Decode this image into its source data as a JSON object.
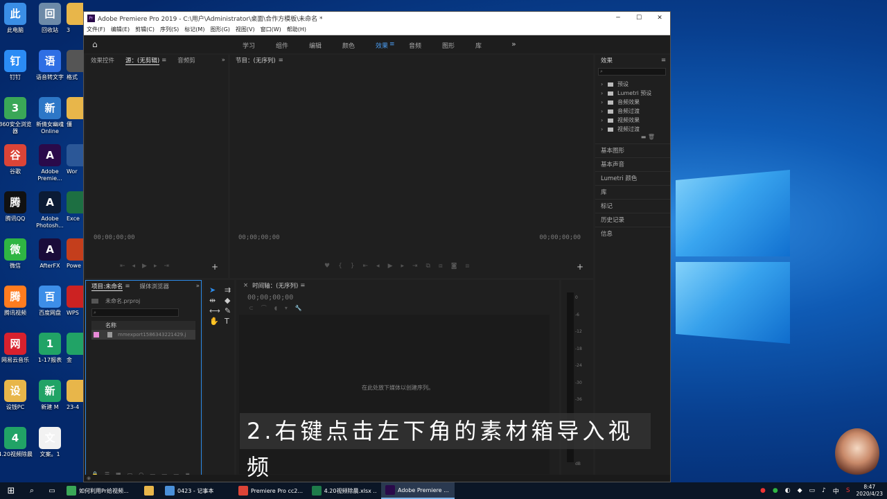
{
  "desktop_icons": [
    {
      "label": "此电脑",
      "icon": "pc-icon",
      "color": "#3a8ee6"
    },
    {
      "label": "回收站",
      "icon": "recycle-bin-icon",
      "color": "#6d8aa8"
    },
    {
      "label": "钉钉",
      "icon": "dingtalk-icon",
      "color": "#2b8cf5"
    },
    {
      "label": "语音转文字",
      "icon": "voice-to-text-icon",
      "color": "#2f6fe4"
    },
    {
      "label": "360安全浏览器",
      "icon": "360-browser-icon",
      "color": "#3aa757"
    },
    {
      "label": "新倩女幽魂Online",
      "icon": "game-icon",
      "color": "#2d77c7"
    },
    {
      "label": "谷歌",
      "icon": "chrome-icon",
      "color": "#db4437"
    },
    {
      "label": "Adobe Premie...",
      "icon": "premiere-icon",
      "color": "#2a0a4a"
    },
    {
      "label": "腾讯QQ",
      "icon": "qq-icon",
      "color": "#111"
    },
    {
      "label": "Adobe Photosh...",
      "icon": "photoshop-icon",
      "color": "#0b1b35"
    },
    {
      "label": "微信",
      "icon": "wechat-icon",
      "color": "#2fb543"
    },
    {
      "label": "AfterFX",
      "icon": "aftereffects-icon",
      "color": "#1a0c3a"
    },
    {
      "label": "腾讯视频",
      "icon": "tencent-video-icon",
      "color": "#ff7c1f"
    },
    {
      "label": "百度网盘",
      "icon": "baidu-netdisk-icon",
      "color": "#3d8ee8"
    },
    {
      "label": "网易云音乐",
      "icon": "netease-music-icon",
      "color": "#d8212e"
    },
    {
      "label": "1-17报表",
      "icon": "spreadsheet-icon",
      "color": "#21a366"
    },
    {
      "label": "设钱PC",
      "icon": "folder-icon",
      "color": "#e8b64a"
    },
    {
      "label": "新建 M",
      "icon": "spreadsheet-icon",
      "color": "#21a366"
    },
    {
      "label": "4.20视频除晨",
      "icon": "spreadsheet-icon",
      "color": "#21a366"
    },
    {
      "label": "文案。1",
      "icon": "document-icon",
      "color": "#f2f2f2"
    }
  ],
  "desktop_icons_col3": [
    {
      "label": "3",
      "icon": "folder-icon",
      "color": "#e8b64a"
    },
    {
      "label": "格式",
      "icon": "app-icon",
      "color": "#555"
    },
    {
      "label": "僵",
      "icon": "folder-icon",
      "color": "#e8b64a"
    },
    {
      "label": "Wor",
      "icon": "word-icon",
      "color": "#2b5797"
    },
    {
      "label": "Exce",
      "icon": "excel-icon",
      "color": "#1d6f42"
    },
    {
      "label": "Powe",
      "icon": "powerpoint-icon",
      "color": "#c43e1c"
    },
    {
      "label": "WPS",
      "icon": "wps-icon",
      "color": "#c22"
    },
    {
      "label": "金",
      "icon": "spreadsheet-icon",
      "color": "#21a366"
    },
    {
      "label": "23-4",
      "icon": "folder-icon",
      "color": "#e8b64a"
    }
  ],
  "window": {
    "title": "Adobe Premiere Pro 2019 - C:\\用户\\Administrator\\桌面\\合作方模板\\未命名 *",
    "menu": [
      "文件(F)",
      "编辑(E)",
      "剪辑(C)",
      "序列(S)",
      "标记(M)",
      "图形(G)",
      "视图(V)",
      "窗口(W)",
      "帮助(H)"
    ],
    "workspaces": [
      "学习",
      "组件",
      "编辑",
      "颜色",
      "效果",
      "音频",
      "图形",
      "库"
    ],
    "active_workspace": "效果"
  },
  "source_panel": {
    "tabs": [
      "效果控件",
      "源：(无剪辑)",
      "音频剪"
    ],
    "active_tab": "源：(无剪辑)",
    "timecode": "00;00;00;00"
  },
  "program_panel": {
    "title": "节目：(无序列)",
    "timecode_left": "00;00;00;00",
    "timecode_right": "00;00;00;00"
  },
  "effects_panel": {
    "title": "效果",
    "tree": [
      "预设",
      "Lumetri 预设",
      "音频效果",
      "音频过渡",
      "视频效果",
      "视频过渡"
    ],
    "side_items": [
      "基本图形",
      "基本声音",
      "Lumetri 颜色",
      "库",
      "标记",
      "历史记录",
      "信息"
    ]
  },
  "project_panel": {
    "tabs": [
      "项目:未命名",
      "媒体浏览器"
    ],
    "project_file": "未命名.prproj",
    "column_header": "名称",
    "items": [
      "mmexport1586343221429.j"
    ]
  },
  "timeline_panel": {
    "title": "时间轴：(无序列)",
    "timecode": "00;00;00;00",
    "drop_hint": "在此处放下媒体以创建序列。"
  },
  "audio_meter": {
    "labels": [
      "0",
      "-6",
      "-12",
      "-18",
      "-24",
      "-30",
      "-36",
      "dB"
    ]
  },
  "subtitle": "2.右键点击左下角的素材箱导入视频",
  "taskbar": {
    "items": [
      {
        "label": "如何利用Pr给视频...",
        "icon": "browser-icon",
        "color": "#3aa757"
      },
      {
        "label": "",
        "icon": "file-explorer-icon",
        "color": "#e8b64a"
      },
      {
        "label": "0423 - 记事本",
        "icon": "notepad-icon",
        "color": "#4a90d9"
      },
      {
        "label": "Premiere Pro cc2...",
        "icon": "chrome-icon",
        "color": "#db4437"
      },
      {
        "label": "4.20视频除晨.xlsx ...",
        "icon": "wps-sheet-icon",
        "color": "#1e7b4a"
      },
      {
        "label": "Adobe Premiere ...",
        "icon": "premiere-icon",
        "color": "#2a0a4a"
      }
    ],
    "active_item": "Adobe Premiere ...",
    "tray": {
      "ime": "中",
      "time": "8:47",
      "date": "2020/4/23"
    }
  }
}
